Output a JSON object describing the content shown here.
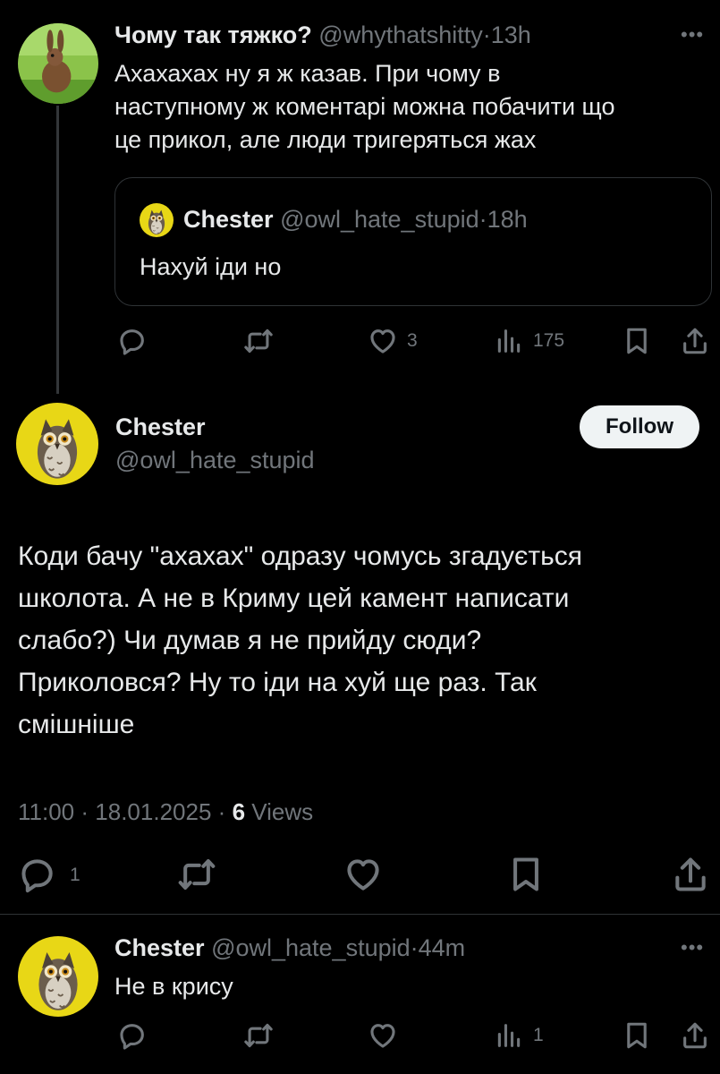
{
  "tweet1": {
    "display_name": "Чому так тяжко?",
    "handle": "@whythatshitty",
    "separator": "·",
    "time": "13h",
    "text_lines": [
      "Ахахахах ну я ж казав. При чому в",
      "наступному ж коментарі можна побачити що",
      "це прикол, але люди тригеряться жах"
    ],
    "avatar_icon": "rabbit-avatar",
    "quote": {
      "display_name": "Chester",
      "handle": "@owl_hate_stupid",
      "separator": "·",
      "time": "18h",
      "text": "Нахуй іди но",
      "avatar_icon": "owl-avatar"
    },
    "actions": {
      "likes": "3",
      "views": "175"
    }
  },
  "main_tweet": {
    "display_name": "Chester",
    "handle": "@owl_hate_stupid",
    "follow_label": "Follow",
    "text_lines": [
      "Коди бачу \"ахахах\" одразу чомусь згадується",
      "школота. А не в Криму цей камент написати",
      "слабо?) Чи думав я не прийду сюди?",
      "Приколовся? Ну то іди на хуй ще раз. Так",
      "смішніше"
    ],
    "time": "11:00",
    "date": "18.01.2025",
    "views_count": "6",
    "views_label": "Views",
    "separator": "·",
    "actions": {
      "replies": "1"
    }
  },
  "reply": {
    "display_name": "Chester",
    "handle": "@owl_hate_stupid",
    "separator": "·",
    "time": "44m",
    "text": "Не в крису",
    "actions": {
      "views": "1"
    }
  },
  "icons": [
    "reply-icon",
    "retweet-icon",
    "like-icon",
    "views-icon",
    "bookmark-icon",
    "share-icon",
    "more-icon"
  ],
  "colors": {
    "background": "#000000",
    "text": "#e7e9ea",
    "muted": "#71767b",
    "follow_bg": "#eff3f4",
    "thread_line": "#333639"
  }
}
